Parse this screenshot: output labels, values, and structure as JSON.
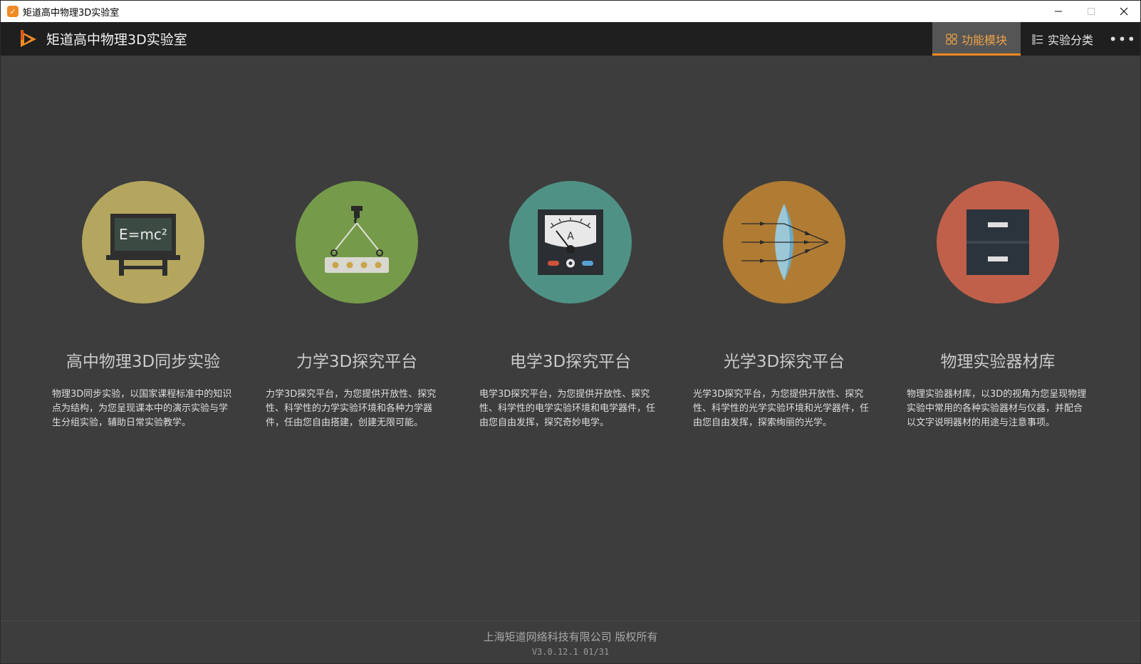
{
  "window": {
    "title": "矩道高中物理3D实验室",
    "controls": [
      "minimize",
      "maximize",
      "close"
    ]
  },
  "header": {
    "title": "矩道高中物理3D实验室",
    "tabs": [
      {
        "label": "功能模块",
        "icon": "grid-icon",
        "active": true
      },
      {
        "label": "实验分类",
        "icon": "list-icon",
        "active": false
      }
    ],
    "more_icon": "more-icon",
    "accent_color": "#f08a24"
  },
  "modules": [
    {
      "title": "高中物理3D同步实验",
      "description": "物理3D同步实验，以国家课程标准中的知识点为结构，为您呈现课本中的演示实验与学生分组实验，辅助日常实验教学。",
      "icon": "blackboard-icon",
      "icon_text": "E=mc²",
      "color": "#b5a65f"
    },
    {
      "title": "力学3D探究平台",
      "description": "力学3D探究平台，为您提供开放性、探究性、科学性的力学实验环境和各种力学器件，任由您自由搭建，创建无限可能。",
      "icon": "hanging-weight-icon",
      "color": "#759b4a"
    },
    {
      "title": "电学3D探究平台",
      "description": "电学3D探究平台，为您提供开放性、探究性、科学性的电学实验环境和电学器件，任由您自由发挥，探究奇妙电学。",
      "icon": "ammeter-icon",
      "icon_text": "A",
      "color": "#4f9285"
    },
    {
      "title": "光学3D探究平台",
      "description": "光学3D探究平台，为您提供开放性、探究性、科学性的光学实验环境和光学器件，任由您自由发挥，探索绚丽的光学。",
      "icon": "lens-icon",
      "color": "#b07c34"
    },
    {
      "title": "物理实验器材库",
      "description": "物理实验器材库，以3D的视角为您呈现物理实验中常用的各种实验器材与仪器，并配合以文字说明器材的用途与注意事项。",
      "icon": "cabinet-icon",
      "color": "#c0604b"
    }
  ],
  "footer": {
    "company": "上海矩道网络科技有限公司 版权所有",
    "version": "V3.0.12.1 01/31"
  }
}
